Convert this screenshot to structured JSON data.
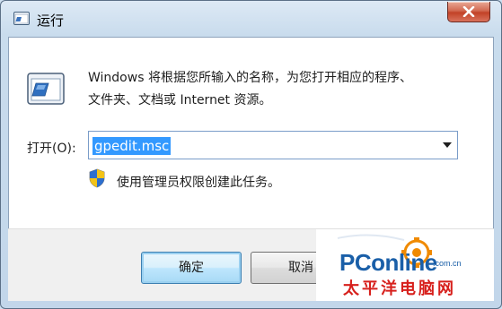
{
  "window": {
    "title": "运行"
  },
  "titlebar": {
    "close_icon": "close-icon",
    "close_color": "#c8442b"
  },
  "content": {
    "description_line1": "Windows 将根据您所输入的名称，为您打开相应的程序、",
    "description_line2": "文件夹、文档或 Internet 资源。",
    "open_label": "打开(O):",
    "open_value": "gpedit.msc",
    "admin_note": "使用管理员权限创建此任务。"
  },
  "footer": {
    "ok_label": "确定",
    "cancel_label": "取消"
  },
  "watermark": {
    "brand": "PConline",
    "domain": ".com.cn",
    "chinese": "太平洋电脑网"
  },
  "colors": {
    "selection": "#3399ff",
    "accent": "#3c7fb1",
    "brand_blue": "#1a5fa8",
    "brand_orange": "#f08a00",
    "brand_red": "#d7201c"
  }
}
